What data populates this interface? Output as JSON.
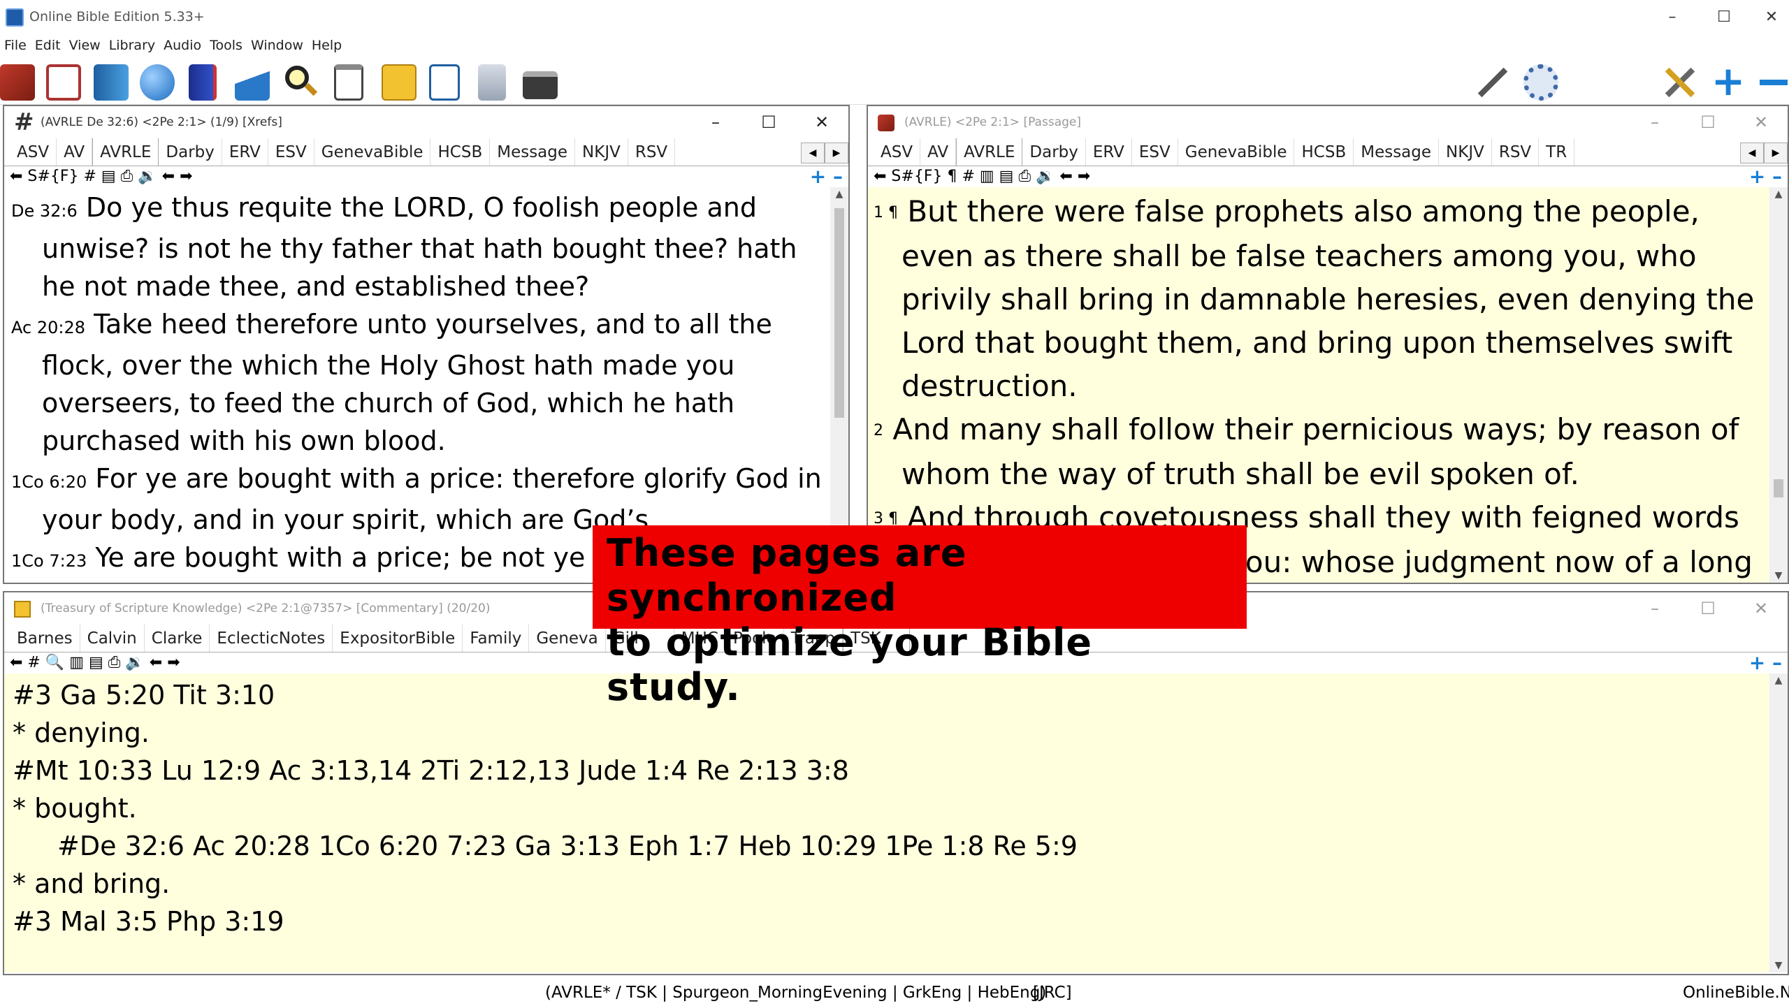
{
  "app": {
    "title": "Online Bible Edition 5.33+"
  },
  "menu": [
    "File",
    "Edit",
    "View",
    "Library",
    "Audio",
    "Tools",
    "Window",
    "Help"
  ],
  "toolbar_icons": [
    "bible-book-icon",
    "notebook-icon",
    "blue-book-icon",
    "globe-icon",
    "dictionary-icon",
    "read-icon",
    "search-icon",
    "clipboard-icon",
    "notes-icon",
    "edit-icon",
    "scroll-icon",
    "print-icon",
    "wrench-icon",
    "gear-icon",
    "tools-icon",
    "plus-icon",
    "minus-icon"
  ],
  "colors": {
    "banner": "#ee0000",
    "highlight_bg": "#ffffde",
    "accent": "#1a7fd4"
  },
  "xrefs": {
    "title": "(AVRLE De 32:6) <2Pe 2:1> (1/9) [Xrefs]",
    "tabs": [
      "ASV",
      "AV",
      "AVRLE",
      "Darby",
      "ERV",
      "ESV",
      "GenevaBible",
      "HCSB",
      "Message",
      "NKJV",
      "RSV"
    ],
    "active_tab": "AVRLE",
    "tools": "⬅ S#{F} # ▤ ⎙ 🔉 ⬅ ➡",
    "verses": [
      {
        "ref": "De 32:6",
        "text": "Do ye thus requite the LORD, O foolish people and unwise? is not he thy father that hath bought thee? hath he not made thee, and established thee?"
      },
      {
        "ref": "Ac 20:28",
        "text": "Take heed therefore unto yourselves, and to all the flock, over the which the Holy Ghost hath made you overseers, to feed the church of God, which he hath purchased with his own blood."
      },
      {
        "ref": "1Co 6:20",
        "text": "For ye are bought with a price: therefore glorify God in your body, and in your spirit, which are God’s."
      },
      {
        "ref": "1Co 7:23",
        "text": "Ye are bought with a price; be not ye the servants of men."
      }
    ]
  },
  "passage": {
    "title": "(AVRLE) <2Pe 2:1> [Passage]",
    "tabs": [
      "ASV",
      "AV",
      "AVRLE",
      "Darby",
      "ERV",
      "ESV",
      "GenevaBible",
      "HCSB",
      "Message",
      "NKJV",
      "RSV",
      "TR"
    ],
    "active_tab": "AVRLE",
    "tools": "⬅ S#{F} ¶ # ▥ ▤ ⎙ 🔉 ⬅ ➡",
    "verses": [
      {
        "num": "1 ¶",
        "text": "But there were false prophets also among the people, even as there shall be false teachers among you, who privily shall bring in damnable heresies, even denying the Lord that bought them, and bring upon themselves swift destruction."
      },
      {
        "num": "2",
        "text": "And many shall follow their pernicious ways; by reason of whom the way of truth shall be evil spoken of."
      },
      {
        "num": "3 ¶",
        "text": "And through covetousness shall they with feigned words make merchandise of you: whose judgment now of a long time lingereth not, and their damnation slumbereth not."
      }
    ]
  },
  "commentary": {
    "title": "(Treasury of Scripture Knowledge) <2Pe 2:1@7357> [Commentary] (20/20)",
    "tabs": [
      "Barnes",
      "Calvin",
      "Clarke",
      "EclecticNotes",
      "ExpositorBible",
      "Family",
      "Geneva",
      "Gill",
      "MHC",
      "Poole",
      "Trapp",
      "TSK"
    ],
    "active_tab": "TSK",
    "tools": "⬅ # 🔍 ▥ ▤ ⎙ 🔉 ⬅ ➡",
    "lines": [
      {
        "text": "#3 Ga 5:20 Tit 3:10",
        "indent": false
      },
      {
        "text": "* denying.",
        "indent": false
      },
      {
        "text": "#Mt 10:33 Lu 12:9 Ac 3:13,14 2Ti 2:12,13 Jude 1:4 Re 2:13 3:8",
        "indent": false
      },
      {
        "text": "* bought.",
        "indent": false
      },
      {
        "text": "#De 32:6 Ac 20:28 1Co 6:20 7:23 Ga 3:13 Eph 1:7 Heb 10:29 1Pe 1:8 Re 5:9",
        "indent": true
      },
      {
        "text": "* and bring.",
        "indent": false
      },
      {
        "text": "#3 Mal 3:5 Php 3:19",
        "indent": false
      }
    ]
  },
  "banner": {
    "line1": "These pages are synchronized",
    "line2": "to optimize your Bible study."
  },
  "status": {
    "modules": "(AVRLE* / TSK | Spurgeon_MorningEvening | GrkEng | HebEng)",
    "user": "[JRC]",
    "site": "OnlineBible.N"
  }
}
